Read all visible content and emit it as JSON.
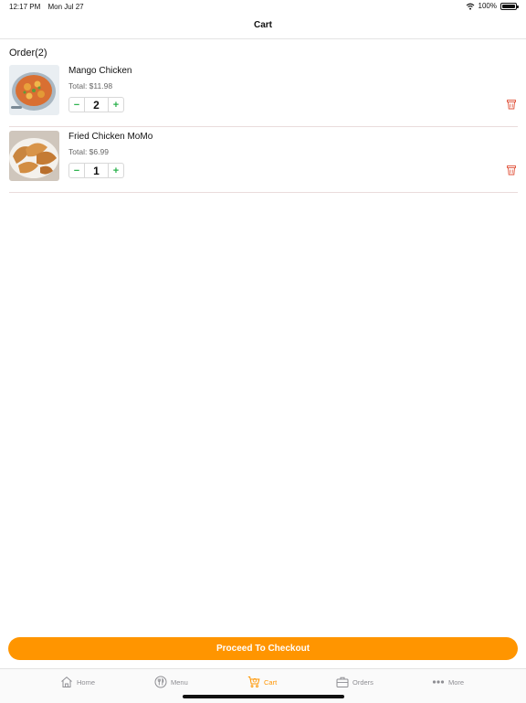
{
  "status": {
    "time": "12:17 PM",
    "date": "Mon Jul 27",
    "battery": "100%"
  },
  "nav": {
    "title": "Cart"
  },
  "order": {
    "header": "Order(2)"
  },
  "items": [
    {
      "name": "Mango Chicken",
      "total": "Total: $11.98",
      "qty": "2",
      "minus": "−",
      "plus": "+"
    },
    {
      "name": "Fried Chicken MoMo",
      "total": "Total: $6.99",
      "qty": "1",
      "minus": "−",
      "plus": "+"
    }
  ],
  "checkout": {
    "label": "Proceed To Checkout"
  },
  "tabs": [
    {
      "label": "Home",
      "icon": "home-icon"
    },
    {
      "label": "Menu",
      "icon": "menu-icon"
    },
    {
      "label": "Cart",
      "icon": "cart-icon",
      "active": true
    },
    {
      "label": "Orders",
      "icon": "orders-icon"
    },
    {
      "label": "More",
      "icon": "more-icon"
    }
  ],
  "colors": {
    "accent": "#ff9500",
    "stepper": "#2bb24c",
    "delete": "#e0523a"
  }
}
